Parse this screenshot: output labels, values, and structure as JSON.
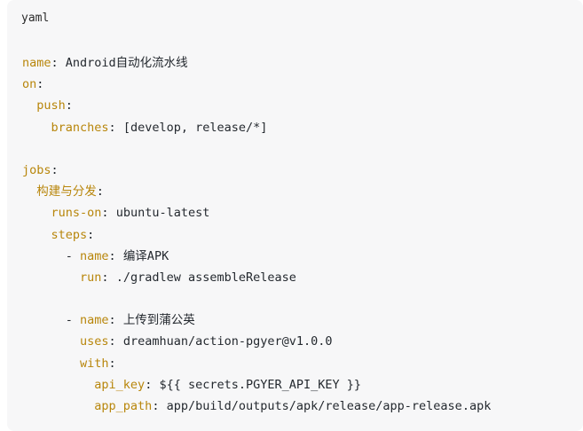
{
  "code_block": {
    "language": "yaml",
    "lines": [
      {
        "indent": "",
        "key": "name",
        "sep": ": ",
        "value": "Android自动化流水线"
      },
      {
        "indent": "",
        "key": "on",
        "sep": ":",
        "value": ""
      },
      {
        "indent": "  ",
        "key": "push",
        "sep": ":",
        "value": ""
      },
      {
        "indent": "    ",
        "key": "branches",
        "sep": ": ",
        "value": "[develop, release/*]"
      },
      {
        "indent": "",
        "key": "",
        "sep": "",
        "value": ""
      },
      {
        "indent": "",
        "key": "jobs",
        "sep": ":",
        "value": ""
      },
      {
        "indent": "  ",
        "key": "构建与分发",
        "sep": ":",
        "value": ""
      },
      {
        "indent": "    ",
        "key": "runs-on",
        "sep": ": ",
        "value": "ubuntu-latest"
      },
      {
        "indent": "    ",
        "key": "steps",
        "sep": ":",
        "value": ""
      },
      {
        "indent": "      - ",
        "key": "name",
        "sep": ": ",
        "value": "编译APK"
      },
      {
        "indent": "        ",
        "key": "run",
        "sep": ": ",
        "value": "./gradlew assembleRelease"
      },
      {
        "indent": "",
        "key": "",
        "sep": "",
        "value": ""
      },
      {
        "indent": "      - ",
        "key": "name",
        "sep": ": ",
        "value": "上传到蒲公英"
      },
      {
        "indent": "        ",
        "key": "uses",
        "sep": ": ",
        "value": "dreamhuan/action-pgyer@v1.0.0"
      },
      {
        "indent": "        ",
        "key": "with",
        "sep": ":",
        "value": ""
      },
      {
        "indent": "          ",
        "key": "api_key",
        "sep": ": ",
        "value": "${{ secrets.PGYER_API_KEY }}"
      },
      {
        "indent": "          ",
        "key": "app_path",
        "sep": ": ",
        "value": "app/build/outputs/apk/release/app-release.apk"
      }
    ]
  },
  "colors": {
    "key": "#b8860b",
    "text": "#24292f",
    "background": "#f7f7f8"
  }
}
